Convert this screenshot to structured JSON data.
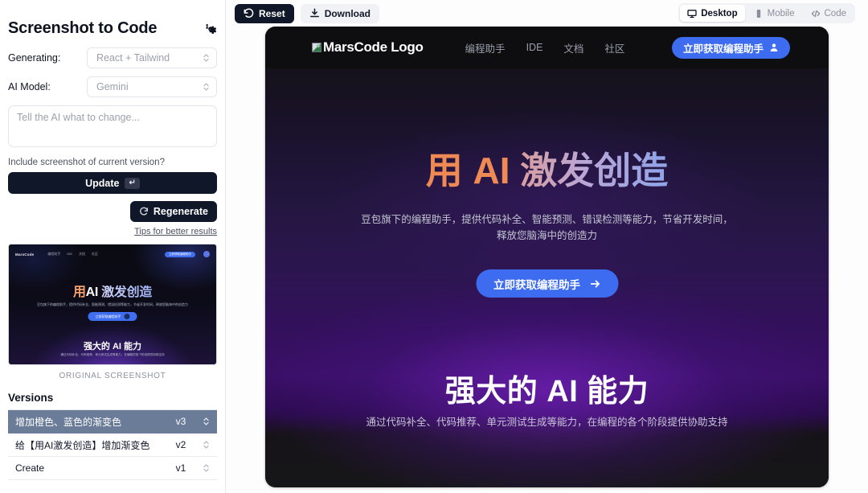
{
  "sidebar": {
    "title": "Screenshot to Code",
    "settings_icon": "gear-icon",
    "generating_label": "Generating:",
    "generating_value": "React + Tailwind",
    "ai_model_label": "AI Model:",
    "ai_model_value": "Gemini",
    "prompt_placeholder": "Tell the AI what to change...",
    "prompt_value": "",
    "include_screenshot_label": "Include screenshot of current version?",
    "update_label": "Update",
    "update_kbd": "↵",
    "regenerate_label": "Regenerate",
    "tips_label": "Tips for better results",
    "original_caption": "ORIGINAL SCREENSHOT",
    "versions_title": "Versions",
    "versions": [
      {
        "name": "增加橙色、蓝色的渐变色",
        "tag": "v3"
      },
      {
        "name": "给【用AI激发创造】增加渐变色",
        "tag": "v2"
      },
      {
        "name": "Create",
        "tag": "v1"
      }
    ]
  },
  "thumbnail": {
    "logo": "MarsCode",
    "nav": [
      "编程助手",
      "IDE",
      "文档",
      "社区"
    ],
    "cta": "立即获取编程助手",
    "h1_a": "用",
    "h1_b": "AI",
    "h1_c": "激发创造",
    "sub": "豆包旗下的编程助手，提供代码补全、智能预测、错误检测等能力，节省开发时间，释放您脑海中的创造力",
    "btn": "立即获取编程助手",
    "h2": "强大的 AI 能力",
    "sub2": "通过代码补全、代码推荐、单元测试生成等能力，在编程的各个阶段提供协助支持"
  },
  "toolbar": {
    "reset_label": "Reset",
    "download_label": "Download",
    "views": [
      {
        "label": "Desktop",
        "icon": "monitor-icon",
        "active": true
      },
      {
        "label": "Mobile",
        "icon": "phone-icon",
        "active": false
      },
      {
        "label": "Code",
        "icon": "code-icon",
        "active": false
      }
    ]
  },
  "preview": {
    "logo_alt": "MarsCode Logo",
    "nav": [
      "编程助手",
      "IDE",
      "文档",
      "社区"
    ],
    "header_cta": "立即获取编程助手",
    "hero_title_orange": "用 AI ",
    "hero_title_grad": "激发创造",
    "hero_sub": "豆包旗下的编程助手，提供代码补全、智能预测、错误检测等能力，节省开发时间，释放您脑海中的创造力",
    "hero_btn": "立即获取编程助手",
    "section2_title": "强大的 AI 能力",
    "section2_sub": "通过代码补全、代码推荐、单元测试生成等能力，在编程的各个阶段提供协助支持"
  },
  "colors": {
    "accent_blue": "#3d6cf0",
    "dark_button": "#101728",
    "hero_orange": "#f08a55",
    "version_active": "#6b7c99"
  }
}
